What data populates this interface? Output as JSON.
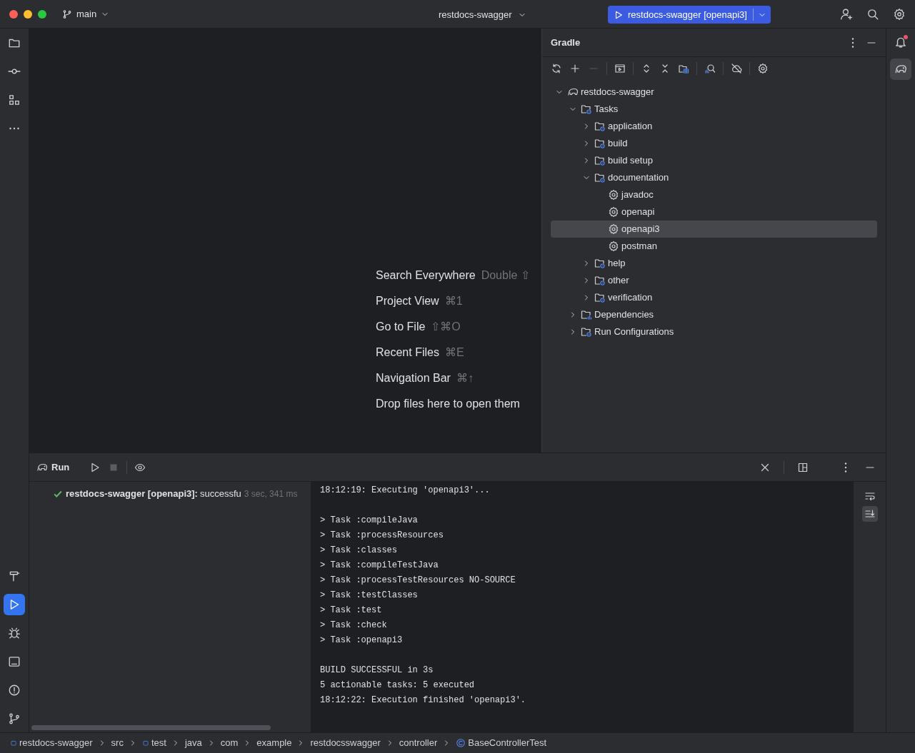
{
  "title_bar": {
    "branch": "main",
    "project": "restdocs-swagger",
    "run_config": "restdocs-swagger [openapi3]"
  },
  "left_toolbar": {
    "top": [
      {
        "kind": "folder",
        "selected": false
      },
      {
        "kind": "commit",
        "selected": false
      },
      {
        "kind": "structure",
        "selected": false
      },
      {
        "kind": "more",
        "selected": false
      }
    ],
    "bottom": [
      {
        "kind": "build",
        "selected": false
      },
      {
        "kind": "run",
        "selected": true
      },
      {
        "kind": "debug",
        "selected": false
      },
      {
        "kind": "terminal",
        "selected": false
      },
      {
        "kind": "problems",
        "selected": false
      },
      {
        "kind": "git",
        "selected": false
      }
    ]
  },
  "editor": {
    "hints": [
      {
        "label": "Search Everywhere",
        "shortcut": "Double ⇧"
      },
      {
        "label": "Project View",
        "shortcut": "⌘1"
      },
      {
        "label": "Go to File",
        "shortcut": "⇧⌘O"
      },
      {
        "label": "Recent Files",
        "shortcut": "⌘E"
      },
      {
        "label": "Navigation Bar",
        "shortcut": "⌘↑"
      },
      {
        "label": "Drop files here to open them"
      }
    ]
  },
  "gradle": {
    "title": "Gradle",
    "tree": [
      {
        "label": "restdocs-swagger",
        "kind": "project",
        "expanded": true,
        "selected": false,
        "children": [
          {
            "label": "Tasks",
            "kind": "folder",
            "expanded": true,
            "selected": false,
            "children": [
              {
                "label": "application",
                "kind": "folder",
                "expanded": false,
                "selected": false
              },
              {
                "label": "build",
                "kind": "folder",
                "expanded": false,
                "selected": false
              },
              {
                "label": "build setup",
                "kind": "folder",
                "expanded": false,
                "selected": false
              },
              {
                "label": "documentation",
                "kind": "folder",
                "expanded": true,
                "selected": false,
                "children": [
                  {
                    "label": "javadoc",
                    "kind": "task",
                    "selected": false
                  },
                  {
                    "label": "openapi",
                    "kind": "task",
                    "selected": false
                  },
                  {
                    "label": "openapi3",
                    "kind": "task",
                    "selected": true
                  },
                  {
                    "label": "postman",
                    "kind": "task",
                    "selected": false
                  }
                ]
              },
              {
                "label": "help",
                "kind": "folder",
                "expanded": false,
                "selected": false
              },
              {
                "label": "other",
                "kind": "folder",
                "expanded": false,
                "selected": false
              },
              {
                "label": "verification",
                "kind": "folder",
                "expanded": false,
                "selected": false
              }
            ]
          },
          {
            "label": "Dependencies",
            "kind": "deps",
            "expanded": false,
            "selected": false
          },
          {
            "label": "Run Configurations",
            "kind": "folder",
            "expanded": false,
            "selected": false
          }
        ]
      }
    ]
  },
  "run_panel": {
    "title": "Run",
    "result": {
      "name": "restdocs-swagger [openapi3]:",
      "status": "successfu",
      "time": "3 sec, 341 ms"
    },
    "console": [
      [
        "18:12:19: Executing 'openapi3'..."
      ],
      [
        "> Task :compileJava",
        "> Task :processResources",
        "> Task :classes",
        "> Task :compileTestJava",
        "> Task :processTestResources NO-SOURCE",
        "> Task :testClasses",
        "> Task :test",
        "> Task :check",
        "> Task :openapi3"
      ],
      [
        "BUILD SUCCESSFUL in 3s",
        "5 actionable tasks: 5 executed",
        "18:12:22: Execution finished 'openapi3'."
      ]
    ],
    "scroll_to_end": true
  },
  "breadcrumbs": [
    {
      "label": "restdocs-swagger",
      "kind": "module"
    },
    {
      "label": "src",
      "kind": "dir"
    },
    {
      "label": "test",
      "kind": "module"
    },
    {
      "label": "java",
      "kind": "dir"
    },
    {
      "label": "com",
      "kind": "dir"
    },
    {
      "label": "example",
      "kind": "dir"
    },
    {
      "label": "restdocsswagger",
      "kind": "dir"
    },
    {
      "label": "controller",
      "kind": "dir"
    },
    {
      "label": "BaseControllerTest",
      "kind": "class"
    }
  ]
}
